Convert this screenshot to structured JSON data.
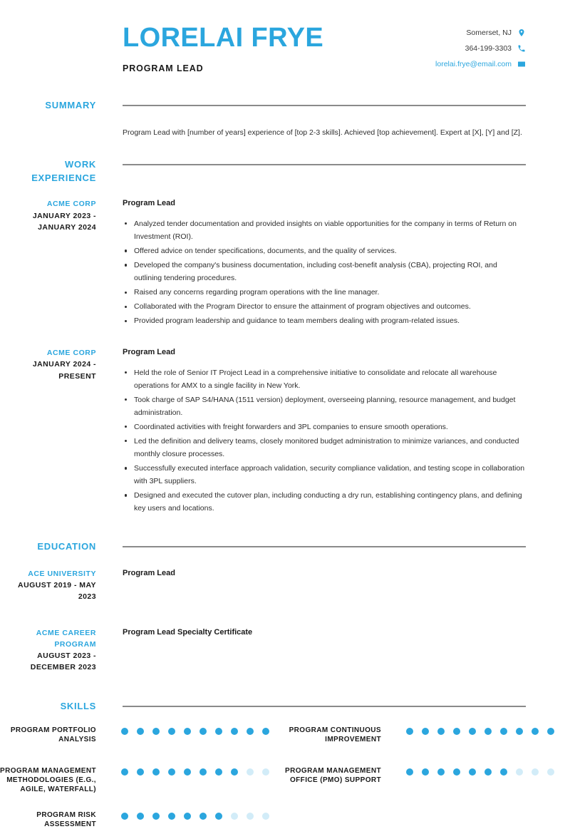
{
  "accent_color": "#2BA6DE",
  "dot_empty_color": "#D2ECF8",
  "rule_color": "#8A8A8A",
  "header": {
    "name": "LORELAI FRYE",
    "job_title": "PROGRAM LEAD",
    "contacts": [
      {
        "text": "Somerset, NJ",
        "icon": "location-pin-icon",
        "is_link": false
      },
      {
        "text": "364-199-3303",
        "icon": "phone-icon",
        "is_link": false
      },
      {
        "text": "lorelai.frye@email.com",
        "icon": "envelope-icon",
        "is_link": true
      }
    ]
  },
  "summary": {
    "title": "SUMMARY",
    "text": "Program Lead with [number of years] experience of [top 2-3 skills]. Achieved [top achievement]. Expert at [X], [Y] and [Z]."
  },
  "work_experience": {
    "title": "WORK EXPERIENCE",
    "entries": [
      {
        "org": "ACME CORP",
        "dates": "JANUARY 2023 - JANUARY 2024",
        "role": "Program Lead",
        "bullets": [
          "Analyzed tender documentation and provided insights on viable opportunities for the company in terms of Return on Investment (ROI).",
          "Offered advice on tender specifications, documents, and the quality of services.",
          "Developed the company's business documentation, including cost-benefit analysis (CBA), projecting ROI, and outlining tendering procedures.",
          "Raised any concerns regarding program operations with the line manager.",
          "Collaborated with the Program Director to ensure the attainment of program objectives and outcomes.",
          "Provided program leadership and guidance to team members dealing with program-related issues."
        ]
      },
      {
        "org": "ACME CORP",
        "dates": "JANUARY 2024 - PRESENT",
        "role": "Program Lead",
        "bullets": [
          "Held the role of Senior IT Project Lead in a comprehensive initiative to consolidate and relocate all warehouse operations for AMX to a single facility in New York.",
          "Took charge of SAP S4/HANA (1511 version) deployment, overseeing planning, resource management, and budget administration.",
          "Coordinated activities with freight forwarders and 3PL companies to ensure smooth operations.",
          "Led the definition and delivery teams, closely monitored budget administration to minimize variances, and conducted monthly closure processes.",
          "Successfully executed interface approach validation, security compliance validation, and testing scope in collaboration with 3PL suppliers.",
          "Designed and executed the cutover plan, including conducting a dry run, establishing contingency plans, and defining key users and locations."
        ]
      }
    ]
  },
  "education": {
    "title": "EDUCATION",
    "entries": [
      {
        "org": "ACE UNIVERSITY",
        "dates": "AUGUST 2019 - MAY 2023",
        "degree": "Program Lead"
      },
      {
        "org": "ACME CAREER PROGRAM",
        "dates": "AUGUST 2023 - DECEMBER 2023",
        "degree": "Program Lead Specialty Certificate"
      }
    ]
  },
  "skills": {
    "title": "SKILLS",
    "max_rating": 10,
    "columns": [
      [
        {
          "label": "PROGRAM PORTFOLIO ANALYSIS",
          "rating": 10
        },
        {
          "label": "PROGRAM MANAGEMENT METHODOLOGIES (E.G., AGILE, WATERFALL)",
          "rating": 8
        },
        {
          "label": "PROGRAM RISK ASSESSMENT",
          "rating": 7
        }
      ],
      [
        {
          "label": "PROGRAM CONTINUOUS IMPROVEMENT",
          "rating": 10
        },
        {
          "label": "PROGRAM MANAGEMENT OFFICE (PMO) SUPPORT",
          "rating": 7
        }
      ]
    ]
  }
}
